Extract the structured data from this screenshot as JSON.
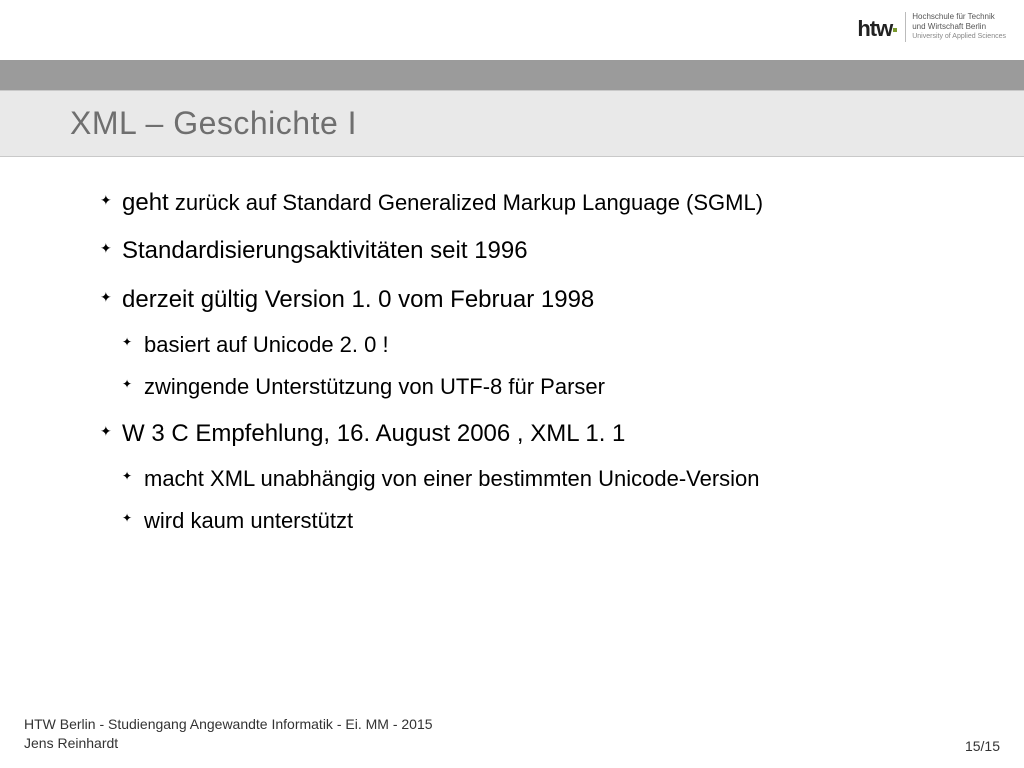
{
  "logo": {
    "mark": "htw",
    "line1": "Hochschule für Technik",
    "line2": "und Wirtschaft Berlin",
    "sub": "University of Applied Sciences"
  },
  "title": "XML – Geschichte I",
  "bullets": {
    "b1_lead": "geht",
    "b1_tail": " zurück auf Standard Generalized Markup Language (SGML)",
    "b2": "Standardisierungsaktivitäten seit 1996",
    "b3": "derzeit gültig Version 1. 0 vom Februar 1998",
    "b3_sub1": "basiert auf Unicode 2. 0 !",
    "b3_sub2": "zwingende Unterstützung von UTF-8 für Parser",
    "b4": "W 3 C Empfehlung, 16. August 2006 , XML 1. 1",
    "b4_sub1": "macht XML unabhängig von einer bestimmten Unicode-Version",
    "b4_sub2": "wird kaum unterstützt"
  },
  "footer": {
    "line1": "HTW Berlin - Studiengang Angewandte Informatik - Ei. MM - 2015",
    "line2": "Jens Reinhardt",
    "page": "15/15"
  }
}
